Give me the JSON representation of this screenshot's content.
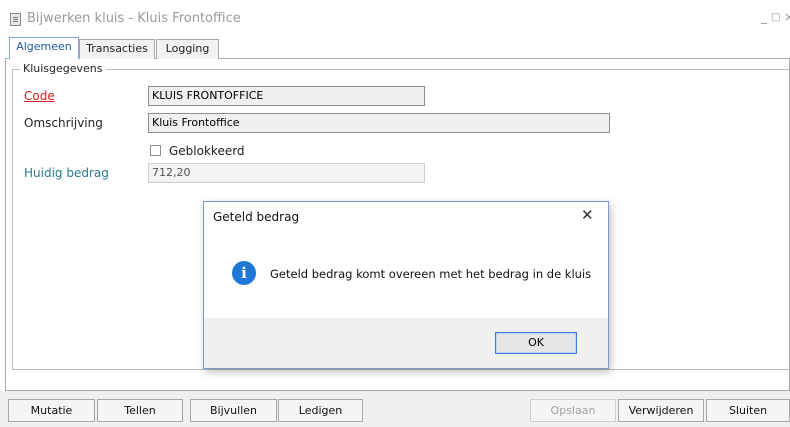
{
  "window": {
    "title": "Bijwerken kluis - Kluis Frontoffice",
    "minimize": "_",
    "maximize": "□",
    "close": "×"
  },
  "tabs": [
    {
      "label": "Algemeen",
      "active": true
    },
    {
      "label": "Transacties",
      "active": false
    },
    {
      "label": "Logging",
      "active": false
    }
  ],
  "group": {
    "title": "Kluisgegevens"
  },
  "form": {
    "code_label": "Code",
    "code_value": "KLUIS FRONTOFFICE",
    "omschrijving_label": "Omschrijving",
    "omschrijving_value": "Kluis Frontoffice",
    "geblokkeerd_label": "Geblokkeerd",
    "geblokkeerd_checked": false,
    "huidig_label": "Huidig bedrag",
    "huidig_value": "712,20"
  },
  "dialog": {
    "title": "Geteld bedrag",
    "close": "✕",
    "icon": "info-icon",
    "message": "Geteld bedrag komt overeen met het bedrag in de kluis",
    "ok_label": "OK"
  },
  "buttons": {
    "mutatie": "Mutatie",
    "tellen": "Tellen",
    "bijvullen": "Bijvullen",
    "ledigen": "Ledigen",
    "opslaan": "Opslaan",
    "verwijderen": "Verwijderen",
    "sluiten": "Sluiten"
  },
  "colors": {
    "required_label": "#d21f1f",
    "readonly_label": "#2a7a8c",
    "info_icon": "#1f78d6",
    "active_tab": "#1f5aa0"
  }
}
